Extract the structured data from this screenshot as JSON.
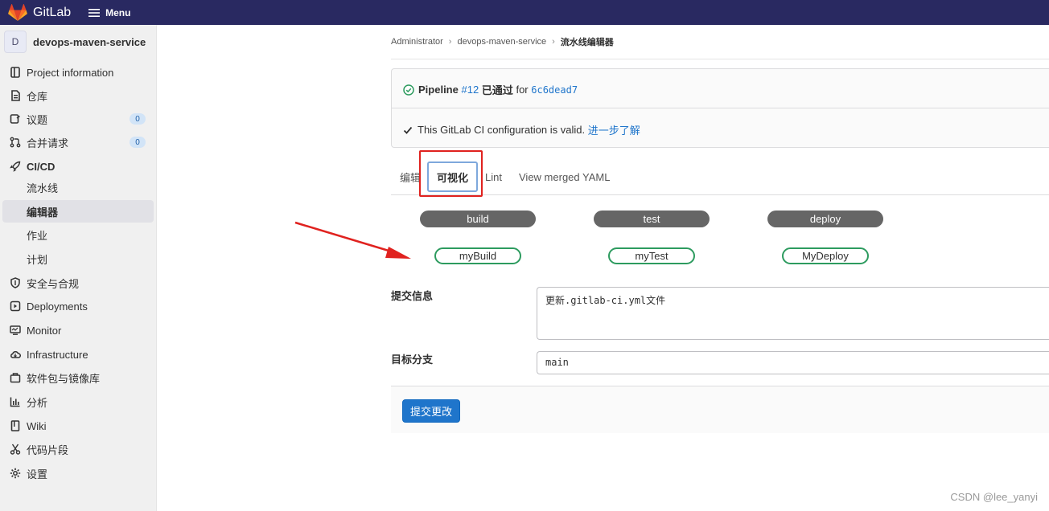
{
  "topbar": {
    "brand": "GitLab",
    "menu_label": "Menu"
  },
  "sidebar": {
    "project_avatar": "D",
    "project_name": "devops-maven-service",
    "items": [
      {
        "label": "Project information",
        "icon": "project-info-icon"
      },
      {
        "label": "仓库",
        "icon": "repository-icon"
      },
      {
        "label": "议题",
        "icon": "issues-icon",
        "badge": "0"
      },
      {
        "label": "合并请求",
        "icon": "merge-request-icon",
        "badge": "0"
      },
      {
        "label": "CI/CD",
        "icon": "rocket-icon"
      },
      {
        "label": "流水线"
      },
      {
        "label": "编辑器",
        "active": true
      },
      {
        "label": "作业"
      },
      {
        "label": "计划"
      },
      {
        "label": "安全与合规",
        "icon": "shield-icon"
      },
      {
        "label": "Deployments",
        "icon": "deployments-icon"
      },
      {
        "label": "Monitor",
        "icon": "monitor-icon"
      },
      {
        "label": "Infrastructure",
        "icon": "cloud-icon"
      },
      {
        "label": "软件包与镜像库",
        "icon": "package-icon"
      },
      {
        "label": "分析",
        "icon": "chart-icon"
      },
      {
        "label": "Wiki",
        "icon": "book-icon"
      },
      {
        "label": "代码片段",
        "icon": "scissors-icon"
      },
      {
        "label": "设置",
        "icon": "settings-icon"
      }
    ]
  },
  "breadcrumb": [
    "Administrator",
    "devops-maven-service",
    "流水线编辑器"
  ],
  "status": {
    "pipeline_label": "Pipeline",
    "pipeline_id": "#12",
    "passed_text": "已通过",
    "for_text": "for",
    "commit_sha": "6c6dead7",
    "valid_text": "This GitLab CI configuration is valid.",
    "learn_more": "进一步了解"
  },
  "tabs": [
    "编辑",
    "可视化",
    "Lint",
    "View merged YAML"
  ],
  "active_tab": "可视化",
  "pipeline_graph": {
    "stages": [
      {
        "name": "build",
        "job": "myBuild"
      },
      {
        "name": "test",
        "job": "myTest"
      },
      {
        "name": "deploy",
        "job": "MyDeploy"
      }
    ]
  },
  "form": {
    "commit_message_label": "提交信息",
    "commit_message_value": "更新.gitlab-ci.yml文件",
    "target_branch_label": "目标分支",
    "target_branch_value": "main",
    "submit_label": "提交更改"
  },
  "watermark": "CSDN @lee_yanyi",
  "colors": {
    "topbar": "#292961",
    "accent": "#1f75cb",
    "success": "#2d9b5f",
    "highlight": "#e0221f"
  }
}
